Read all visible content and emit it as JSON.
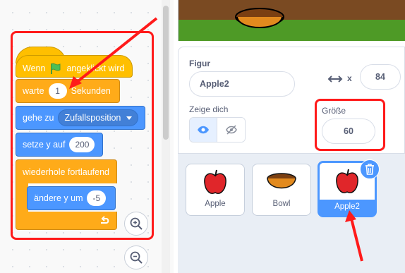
{
  "blocks": {
    "when_flag": {
      "before": "Wenn",
      "after": "angeklickt wird"
    },
    "wait": {
      "label": "warte",
      "value": "1",
      "suffix": "Sekunden"
    },
    "goto": {
      "label": "gehe zu",
      "target": "Zufallsposition"
    },
    "set_y": {
      "label": "setze y auf",
      "value": "200"
    },
    "forever": {
      "label": "wiederhole fortlaufend"
    },
    "change_y": {
      "label": "ändere y um",
      "value": "-5"
    }
  },
  "sprite_info": {
    "figure_label": "Figur",
    "name": "Apple2",
    "x_label": "x",
    "x_value": "84",
    "show_label": "Zeige dich",
    "size_label": "Größe",
    "size_value": "60"
  },
  "sprites": [
    {
      "name": "Apple",
      "icon": "apple-icon"
    },
    {
      "name": "Bowl",
      "icon": "bowl-icon"
    },
    {
      "name": "Apple2",
      "icon": "apple-icon",
      "selected": true
    }
  ],
  "colors": {
    "events": "#ffbf00",
    "control": "#ffab19",
    "motion": "#4c97ff",
    "annotation": "#ff1a1a"
  }
}
